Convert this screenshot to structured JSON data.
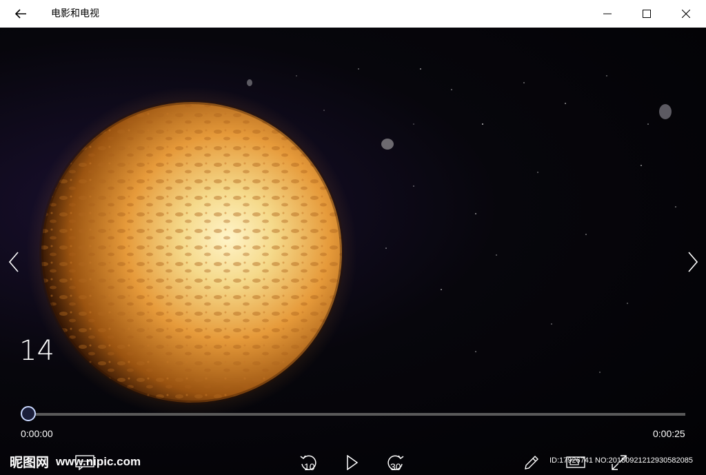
{
  "titlebar": {
    "app_title": "电影和电视",
    "back_icon": "back-arrow-icon",
    "minimize_icon": "minimize-icon",
    "maximize_icon": "maximize-icon",
    "close_icon": "close-icon"
  },
  "player": {
    "item_number": "14",
    "time_current": "0:00:00",
    "time_total": "0:00:25",
    "progress": 0.0,
    "prev_icon": "chevron-left-icon",
    "next_icon": "chevron-right-icon",
    "colors": {
      "planet_light": "#f5d98a",
      "planet_mid": "#e69a3a",
      "planet_dark": "#7a3e0c",
      "thumb_border": "#c9d8ff",
      "track": "#5a5a5a"
    }
  },
  "controls": {
    "rewind_label": "10",
    "forward_label": "30",
    "subtitle_icon": "subtitles-icon",
    "rewind_icon": "rewind-10-icon",
    "play_icon": "play-icon",
    "forward_icon": "forward-30-icon",
    "edit_icon": "pencil-icon",
    "cast_icon": "cast-to-device-icon",
    "fullscreen_icon": "fullscreen-icon"
  },
  "watermark": {
    "logo_text": "昵图网",
    "site_text": "www.nipic.com",
    "id_text": "ID:17926741 NO:20180921212930582085"
  }
}
